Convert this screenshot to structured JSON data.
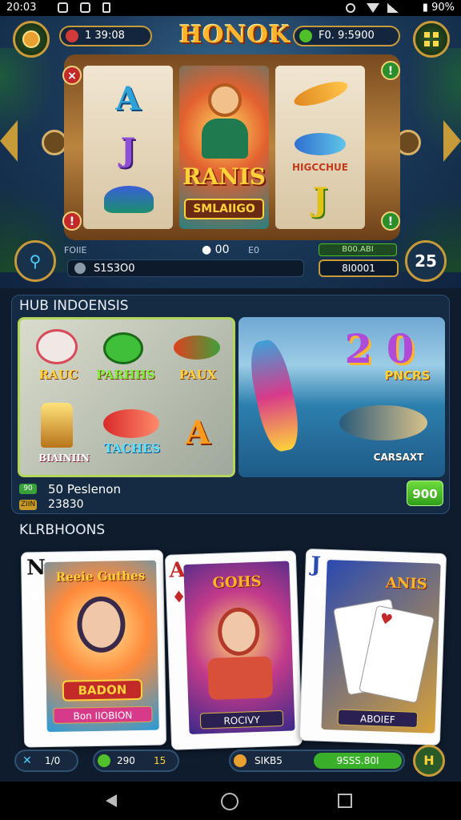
{
  "status_bar": {
    "time": "20:03",
    "battery": "90%"
  },
  "header": {
    "title": "HONOK",
    "balance_left": "1 39:08",
    "balance_right": "F0. 9:5900"
  },
  "slot": {
    "reel1_symbols": [
      "A",
      "J",
      ""
    ],
    "reel2_title": "RANIS",
    "reel2_subtitle": "SMLAIIGO",
    "reel3_label": "HIGCCHUE",
    "reel3_letter": "J",
    "left_badge": "FOIIE",
    "bet_value": "S1S3O0",
    "center_value": "00",
    "center_tag": "E0",
    "right_top": "B00.ABI",
    "right_bottom": "8I0001",
    "right_circle": "25"
  },
  "hub": {
    "title": "HUB INDOENSIS",
    "items": [
      "RAUC",
      "PARHHS",
      "PAUX",
      "BIAINIIN",
      "TACHES"
    ],
    "right_big_text": "2 0",
    "right_label_top": "PNCRS",
    "right_label_bottom": "CARSAXT",
    "row1_text": "50 Peslenon",
    "row1_tag": "90",
    "row2_text": "23830",
    "row2_tag": "ZIIN",
    "action_label": "900"
  },
  "cards_section": {
    "title": "KLRBHOONS",
    "cards": [
      {
        "rank": "N",
        "header": "Reeie Guthes",
        "banner": "BADON",
        "caption": "Bon IIOBION"
      },
      {
        "rank": "A",
        "header": "GOHS",
        "caption": "ROCIVY"
      },
      {
        "rank": "J",
        "header": "ANIS",
        "caption": "ABOIEF"
      }
    ]
  },
  "bottom": {
    "left": "1/0",
    "mid1": "290",
    "mid1_tag": "15",
    "mid2": "SIKB5",
    "mid2_right": "9SSS.80I"
  },
  "colors": {
    "gold": "#c79a3a",
    "green": "#4fbf2a",
    "bg": "#0f1c2e"
  }
}
